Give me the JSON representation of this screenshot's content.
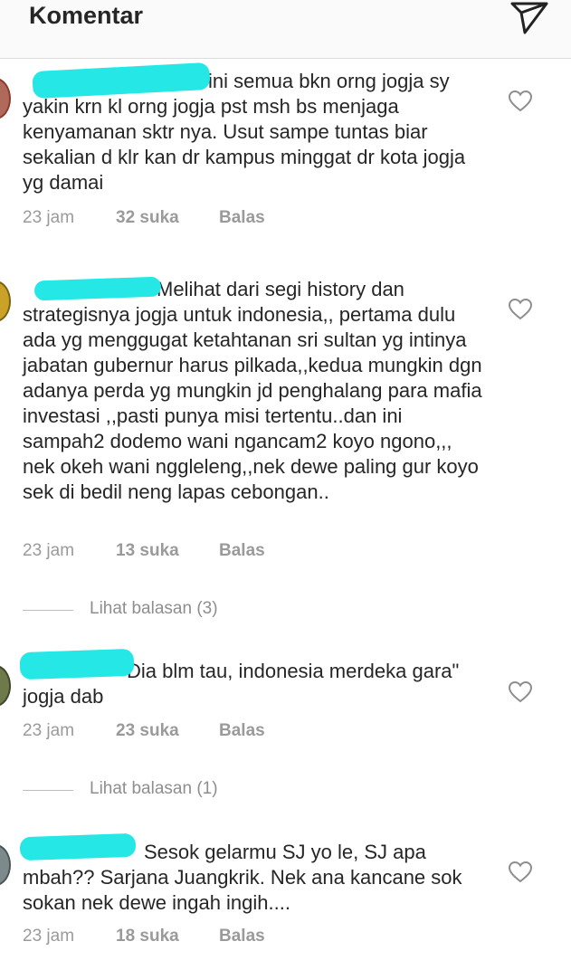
{
  "header": {
    "title": "Komentar",
    "icon": "send-icon"
  },
  "comments": [
    {
      "text": "ini semua bkn orng jogja sy yakin krn kl orng jogja pst msh bs menjaga kenyamanan sktr nya. Usut sampe tuntas biar sekalian d klr kan dr kampus minggat dr kota jogja yg damai",
      "time": "23 jam",
      "likes": "32 suka",
      "reply": "Balas"
    },
    {
      "text": "Melihat dari segi history dan strategisnya jogja untuk indonesia,, pertama dulu ada yg menggugat ketahtanan sri sultan yg intinya jabatan gubernur harus pilkada,,kedua mungkin dgn adanya perda yg mungkin jd penghalang para mafia investasi ,,pasti punya misi tertentu..dan ini sampah2 dodemo wani ngancam2 koyo ngono,,, nek okeh wani nggleleng,,nek dewe paling gur koyo sek di bedil neng lapas cebongan..",
      "time": "23 jam",
      "likes": "13 suka",
      "reply": "Balas",
      "view_replies": "Lihat balasan (3)"
    },
    {
      "text": "Dia blm tau, indonesia merdeka gara\" jogja dab",
      "time": "23 jam",
      "likes": "23 suka",
      "reply": "Balas",
      "view_replies": "Lihat balasan (1)"
    },
    {
      "text": "Sesok gelarmu SJ yo le, SJ apa mbah?? Sarjana Juangkrik. Nek ana kancane sok sokan nek dewe ingah ingih....",
      "time": "23 jam",
      "likes": "18 suka",
      "reply": "Balas"
    }
  ],
  "colors": {
    "redaction": "#25e7e5",
    "meta_text": "#9a9a9a"
  }
}
